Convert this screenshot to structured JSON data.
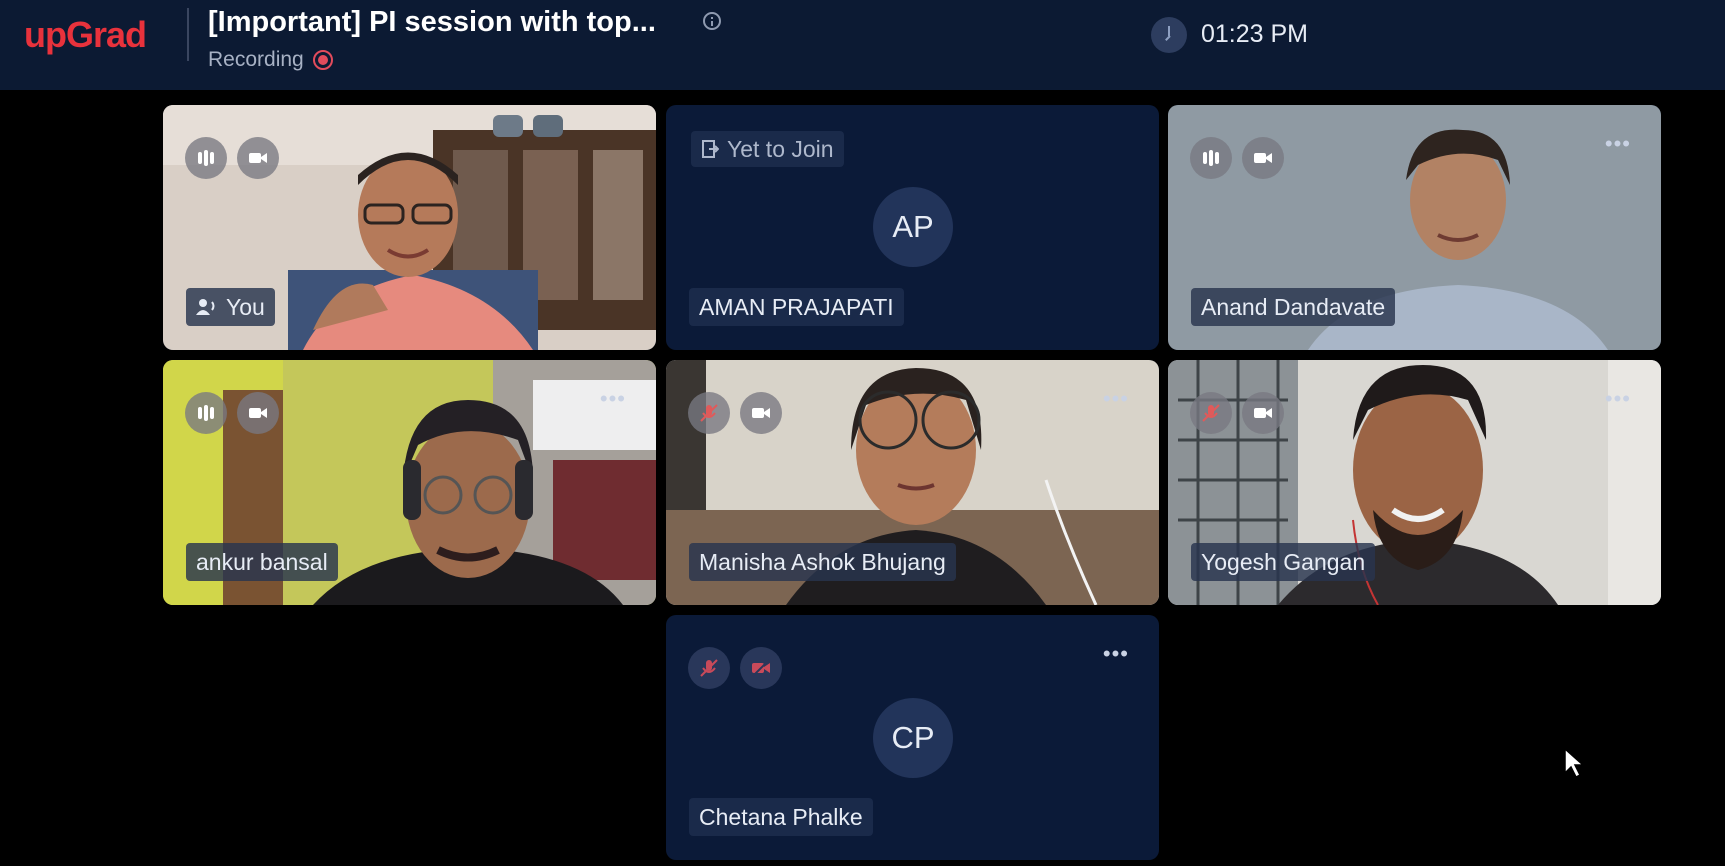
{
  "header": {
    "logo": "upGrad",
    "title": "[Important] PI session with top...",
    "recording_label": "Recording",
    "time": "01:23 PM"
  },
  "participants": [
    {
      "name": "You",
      "status": "",
      "initials": "",
      "mic": "on",
      "camera": "on"
    },
    {
      "name": "AMAN PRAJAPATI",
      "status": "Yet to Join",
      "initials": "AP",
      "mic": "",
      "camera": ""
    },
    {
      "name": "Anand Dandavate",
      "status": "",
      "initials": "",
      "mic": "on",
      "camera": "on"
    },
    {
      "name": "ankur bansal",
      "status": "",
      "initials": "",
      "mic": "on",
      "camera": "on"
    },
    {
      "name": "Manisha Ashok Bhujang",
      "status": "",
      "initials": "",
      "mic": "muted",
      "camera": "on"
    },
    {
      "name": "Yogesh Gangan",
      "status": "",
      "initials": "",
      "mic": "muted",
      "camera": "on"
    },
    {
      "name": "Chetana Phalke",
      "status": "",
      "initials": "CP",
      "mic": "muted",
      "camera": "off"
    }
  ],
  "colors": {
    "header_bg": "#0c1a33",
    "tile_bg": "#0b1a38",
    "brand_red": "#e8323c",
    "recording_red": "#e24b5c"
  },
  "icons": {
    "info": "info-icon",
    "recording": "record-icon",
    "clock": "clock-icon",
    "mic": "mic-icon",
    "mic_muted": "mic-muted-icon",
    "camera": "camera-icon",
    "camera_off": "camera-off-icon",
    "more": "more-icon",
    "speaker": "speaker-icon",
    "join": "join-icon"
  }
}
